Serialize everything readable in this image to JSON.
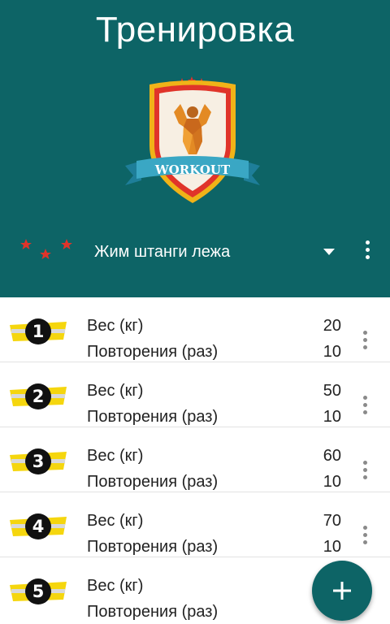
{
  "header": {
    "title": "Тренировка",
    "logo_text": "WORKOUT",
    "exercise": "Жим штанги лежа"
  },
  "sets": [
    {
      "number": "1",
      "weight_label": "Вес (кг)",
      "weight": "20",
      "reps_label": "Повторения (раз)",
      "reps": "10"
    },
    {
      "number": "2",
      "weight_label": "Вес (кг)",
      "weight": "50",
      "reps_label": "Повторения (раз)",
      "reps": "10"
    },
    {
      "number": "3",
      "weight_label": "Вес (кг)",
      "weight": "60",
      "reps_label": "Повторения (раз)",
      "reps": "10"
    },
    {
      "number": "4",
      "weight_label": "Вес (кг)",
      "weight": "70",
      "reps_label": "Повторения (раз)",
      "reps": "10"
    },
    {
      "number": "5",
      "weight_label": "Вес (кг)",
      "weight": "",
      "reps_label": "Повторения (раз)",
      "reps": ""
    }
  ],
  "colors": {
    "primary": "#0d6466",
    "badge_yellow": "#f5d60e",
    "star_red": "#e0342a"
  },
  "icons": {
    "fab": "plus-icon",
    "dropdown": "caret-down-icon",
    "menu": "more-vertical-icon"
  }
}
